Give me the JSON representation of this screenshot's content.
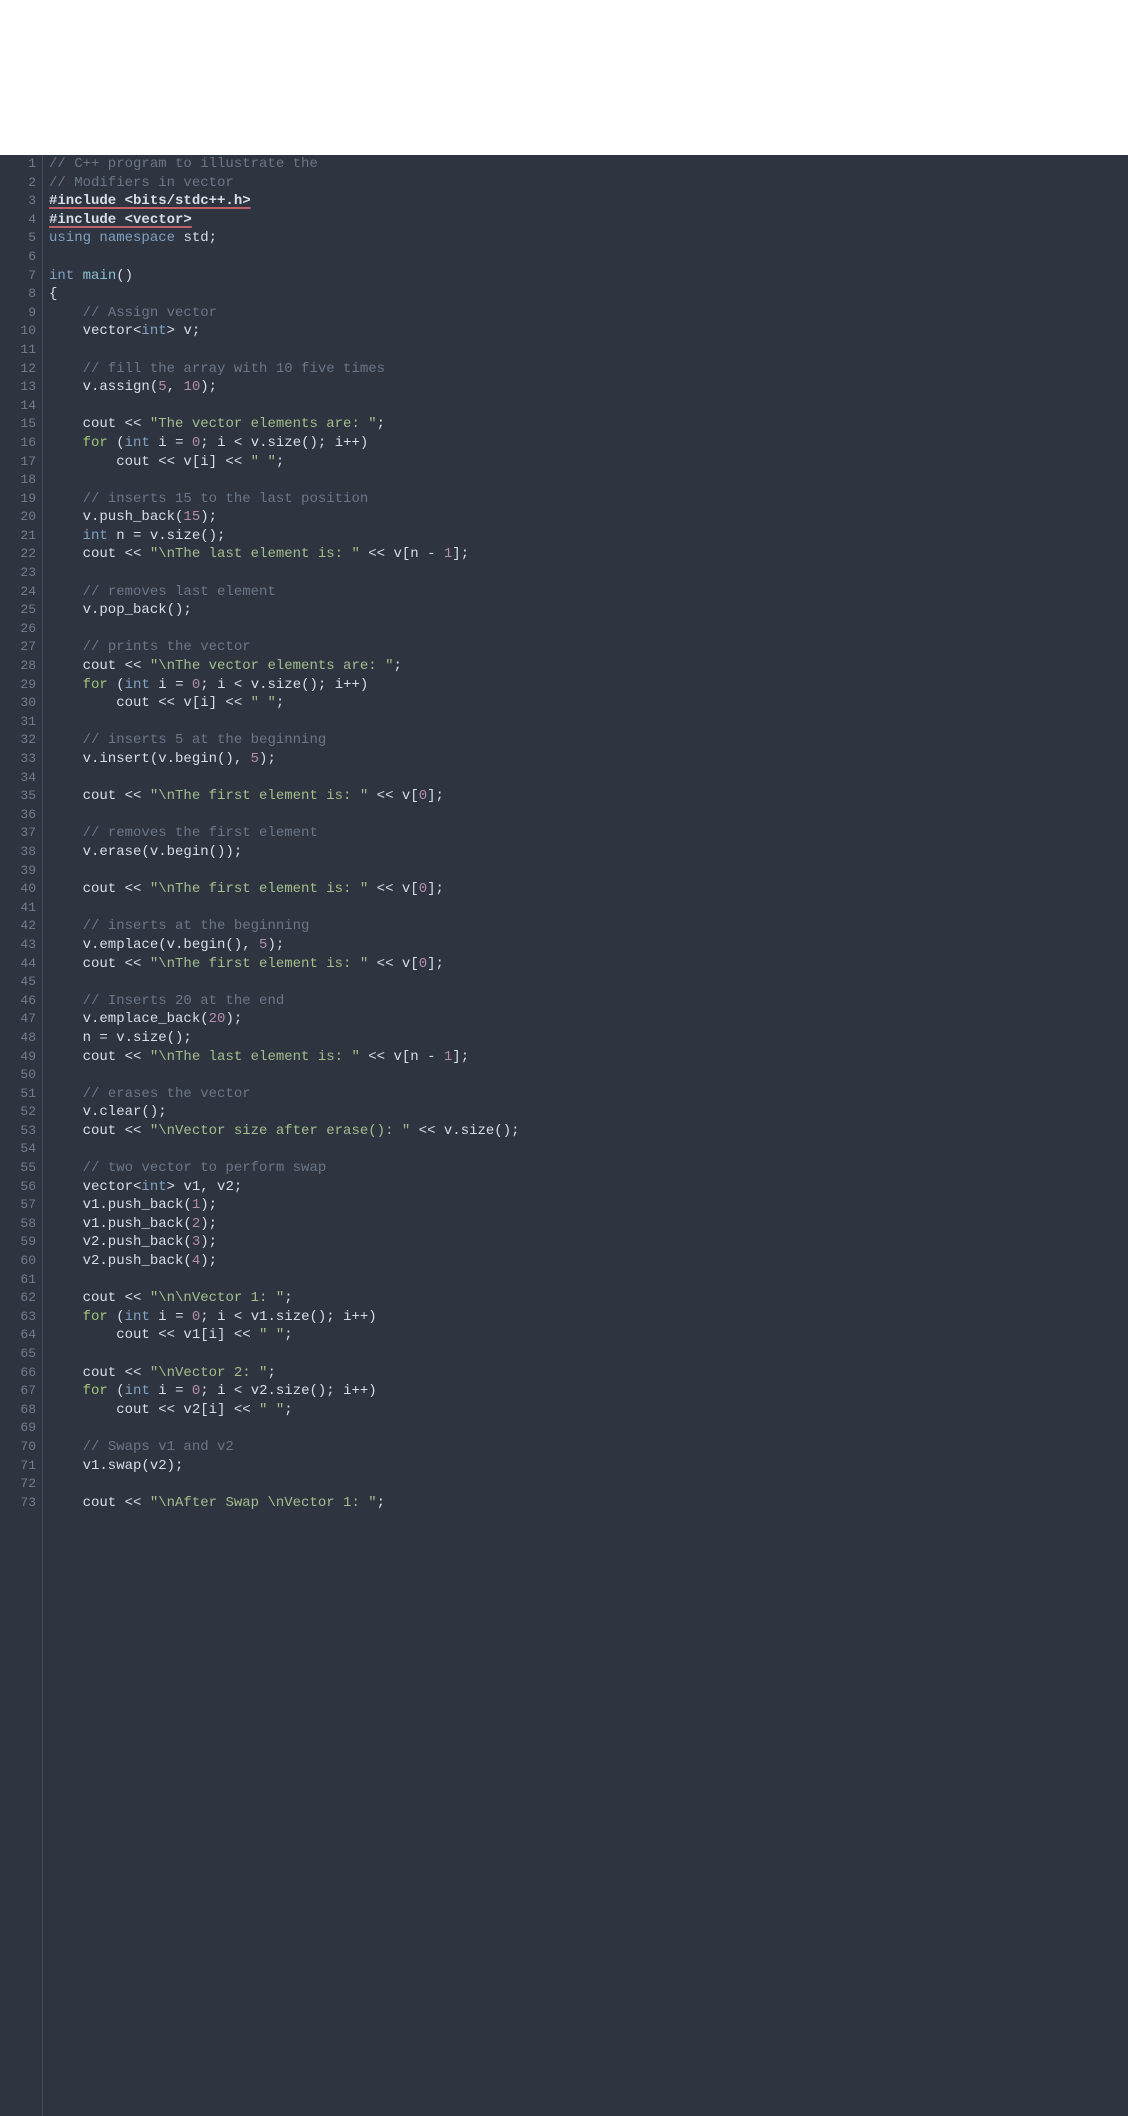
{
  "lines": [
    {
      "n": 1,
      "segs": [
        {
          "c": "tok-comment",
          "t": "// C++ program to illustrate the"
        }
      ]
    },
    {
      "n": 2,
      "segs": [
        {
          "c": "tok-comment",
          "t": "// Modifiers in vector"
        }
      ]
    },
    {
      "n": 3,
      "segs": [
        {
          "c": "tok-preproc tok-preproc-u",
          "t": "#include <bits/stdc++.h>"
        }
      ]
    },
    {
      "n": 4,
      "segs": [
        {
          "c": "tok-preproc tok-preproc-u",
          "t": "#include <vector>"
        }
      ]
    },
    {
      "n": 5,
      "segs": [
        {
          "c": "tok-keyword",
          "t": "using "
        },
        {
          "c": "tok-keyword",
          "t": "namespace "
        },
        {
          "c": "tok-default",
          "t": "std;"
        }
      ]
    },
    {
      "n": 6,
      "segs": []
    },
    {
      "n": 7,
      "segs": [
        {
          "c": "tok-keyword",
          "t": "int "
        },
        {
          "c": "tok-func",
          "t": "main"
        },
        {
          "c": "tok-default",
          "t": "()"
        }
      ]
    },
    {
      "n": 8,
      "segs": [
        {
          "c": "tok-default",
          "t": "{"
        }
      ]
    },
    {
      "n": 9,
      "segs": [
        {
          "c": "tok-default",
          "t": "    "
        },
        {
          "c": "tok-comment",
          "t": "// Assign vector"
        }
      ]
    },
    {
      "n": 10,
      "segs": [
        {
          "c": "tok-default",
          "t": "    vector<"
        },
        {
          "c": "tok-keyword",
          "t": "int"
        },
        {
          "c": "tok-default",
          "t": "> v;"
        }
      ]
    },
    {
      "n": 11,
      "segs": []
    },
    {
      "n": 12,
      "segs": [
        {
          "c": "tok-default",
          "t": "    "
        },
        {
          "c": "tok-comment",
          "t": "// fill the array with 10 five times"
        }
      ]
    },
    {
      "n": 13,
      "segs": [
        {
          "c": "tok-default",
          "t": "    v.assign("
        },
        {
          "c": "tok-number",
          "t": "5"
        },
        {
          "c": "tok-default",
          "t": ", "
        },
        {
          "c": "tok-number",
          "t": "10"
        },
        {
          "c": "tok-default",
          "t": ");"
        }
      ]
    },
    {
      "n": 14,
      "segs": []
    },
    {
      "n": 15,
      "segs": [
        {
          "c": "tok-default",
          "t": "    cout << "
        },
        {
          "c": "tok-string",
          "t": "\"The vector elements are: \""
        },
        {
          "c": "tok-default",
          "t": ";"
        }
      ]
    },
    {
      "n": 16,
      "segs": [
        {
          "c": "tok-default",
          "t": "    "
        },
        {
          "c": "tok-keyword2",
          "t": "for"
        },
        {
          "c": "tok-default",
          "t": " ("
        },
        {
          "c": "tok-keyword",
          "t": "int"
        },
        {
          "c": "tok-default",
          "t": " i = "
        },
        {
          "c": "tok-number",
          "t": "0"
        },
        {
          "c": "tok-default",
          "t": "; i < v.size(); i++)"
        }
      ]
    },
    {
      "n": 17,
      "segs": [
        {
          "c": "tok-default",
          "t": "        cout << v[i] << "
        },
        {
          "c": "tok-string",
          "t": "\" \""
        },
        {
          "c": "tok-default",
          "t": ";"
        }
      ]
    },
    {
      "n": 18,
      "segs": []
    },
    {
      "n": 19,
      "segs": [
        {
          "c": "tok-default",
          "t": "    "
        },
        {
          "c": "tok-comment",
          "t": "// inserts 15 to the last position"
        }
      ]
    },
    {
      "n": 20,
      "segs": [
        {
          "c": "tok-default",
          "t": "    v.push_back("
        },
        {
          "c": "tok-number",
          "t": "15"
        },
        {
          "c": "tok-default",
          "t": ");"
        }
      ]
    },
    {
      "n": 21,
      "segs": [
        {
          "c": "tok-default",
          "t": "    "
        },
        {
          "c": "tok-keyword",
          "t": "int"
        },
        {
          "c": "tok-default",
          "t": " n = v.size();"
        }
      ]
    },
    {
      "n": 22,
      "segs": [
        {
          "c": "tok-default",
          "t": "    cout << "
        },
        {
          "c": "tok-string",
          "t": "\"\\nThe last element is: \""
        },
        {
          "c": "tok-default",
          "t": " << v[n - "
        },
        {
          "c": "tok-number",
          "t": "1"
        },
        {
          "c": "tok-default",
          "t": "];"
        }
      ]
    },
    {
      "n": 23,
      "segs": []
    },
    {
      "n": 24,
      "segs": [
        {
          "c": "tok-default",
          "t": "    "
        },
        {
          "c": "tok-comment",
          "t": "// removes last element"
        }
      ]
    },
    {
      "n": 25,
      "segs": [
        {
          "c": "tok-default",
          "t": "    v.pop_back();"
        }
      ]
    },
    {
      "n": 26,
      "segs": []
    },
    {
      "n": 27,
      "segs": [
        {
          "c": "tok-default",
          "t": "    "
        },
        {
          "c": "tok-comment",
          "t": "// prints the vector"
        }
      ]
    },
    {
      "n": 28,
      "segs": [
        {
          "c": "tok-default",
          "t": "    cout << "
        },
        {
          "c": "tok-string",
          "t": "\"\\nThe vector elements are: \""
        },
        {
          "c": "tok-default",
          "t": ";"
        }
      ]
    },
    {
      "n": 29,
      "segs": [
        {
          "c": "tok-default",
          "t": "    "
        },
        {
          "c": "tok-keyword2",
          "t": "for"
        },
        {
          "c": "tok-default",
          "t": " ("
        },
        {
          "c": "tok-keyword",
          "t": "int"
        },
        {
          "c": "tok-default",
          "t": " i = "
        },
        {
          "c": "tok-number",
          "t": "0"
        },
        {
          "c": "tok-default",
          "t": "; i < v.size(); i++)"
        }
      ]
    },
    {
      "n": 30,
      "segs": [
        {
          "c": "tok-default",
          "t": "        cout << v[i] << "
        },
        {
          "c": "tok-string",
          "t": "\" \""
        },
        {
          "c": "tok-default",
          "t": ";"
        }
      ]
    },
    {
      "n": 31,
      "segs": []
    },
    {
      "n": 32,
      "segs": [
        {
          "c": "tok-default",
          "t": "    "
        },
        {
          "c": "tok-comment",
          "t": "// inserts 5 at the beginning"
        }
      ]
    },
    {
      "n": 33,
      "segs": [
        {
          "c": "tok-default",
          "t": "    v.insert(v.begin(), "
        },
        {
          "c": "tok-number",
          "t": "5"
        },
        {
          "c": "tok-default",
          "t": ");"
        }
      ]
    },
    {
      "n": 34,
      "segs": []
    },
    {
      "n": 35,
      "segs": [
        {
          "c": "tok-default",
          "t": "    cout << "
        },
        {
          "c": "tok-string",
          "t": "\"\\nThe first element is: \""
        },
        {
          "c": "tok-default",
          "t": " << v["
        },
        {
          "c": "tok-number",
          "t": "0"
        },
        {
          "c": "tok-default",
          "t": "];"
        }
      ]
    },
    {
      "n": 36,
      "segs": []
    },
    {
      "n": 37,
      "segs": [
        {
          "c": "tok-default",
          "t": "    "
        },
        {
          "c": "tok-comment",
          "t": "// removes the first element"
        }
      ]
    },
    {
      "n": 38,
      "segs": [
        {
          "c": "tok-default",
          "t": "    v.erase(v.begin());"
        }
      ]
    },
    {
      "n": 39,
      "segs": []
    },
    {
      "n": 40,
      "segs": [
        {
          "c": "tok-default",
          "t": "    cout << "
        },
        {
          "c": "tok-string",
          "t": "\"\\nThe first element is: \""
        },
        {
          "c": "tok-default",
          "t": " << v["
        },
        {
          "c": "tok-number",
          "t": "0"
        },
        {
          "c": "tok-default",
          "t": "];"
        }
      ]
    },
    {
      "n": 41,
      "segs": []
    },
    {
      "n": 42,
      "segs": [
        {
          "c": "tok-default",
          "t": "    "
        },
        {
          "c": "tok-comment",
          "t": "// inserts at the beginning"
        }
      ]
    },
    {
      "n": 43,
      "segs": [
        {
          "c": "tok-default",
          "t": "    v.emplace(v.begin(), "
        },
        {
          "c": "tok-number",
          "t": "5"
        },
        {
          "c": "tok-default",
          "t": ");"
        }
      ]
    },
    {
      "n": 44,
      "segs": [
        {
          "c": "tok-default",
          "t": "    cout << "
        },
        {
          "c": "tok-string",
          "t": "\"\\nThe first element is: \""
        },
        {
          "c": "tok-default",
          "t": " << v["
        },
        {
          "c": "tok-number",
          "t": "0"
        },
        {
          "c": "tok-default",
          "t": "];"
        }
      ]
    },
    {
      "n": 45,
      "segs": []
    },
    {
      "n": 46,
      "segs": [
        {
          "c": "tok-default",
          "t": "    "
        },
        {
          "c": "tok-comment",
          "t": "// Inserts 20 at the end"
        }
      ]
    },
    {
      "n": 47,
      "segs": [
        {
          "c": "tok-default",
          "t": "    v.emplace_back("
        },
        {
          "c": "tok-number",
          "t": "20"
        },
        {
          "c": "tok-default",
          "t": ");"
        }
      ]
    },
    {
      "n": 48,
      "segs": [
        {
          "c": "tok-default",
          "t": "    n = v.size();"
        }
      ]
    },
    {
      "n": 49,
      "segs": [
        {
          "c": "tok-default",
          "t": "    cout << "
        },
        {
          "c": "tok-string",
          "t": "\"\\nThe last element is: \""
        },
        {
          "c": "tok-default",
          "t": " << v[n - "
        },
        {
          "c": "tok-number",
          "t": "1"
        },
        {
          "c": "tok-default",
          "t": "];"
        }
      ]
    },
    {
      "n": 50,
      "segs": []
    },
    {
      "n": 51,
      "segs": [
        {
          "c": "tok-default",
          "t": "    "
        },
        {
          "c": "tok-comment",
          "t": "// erases the vector"
        }
      ]
    },
    {
      "n": 52,
      "segs": [
        {
          "c": "tok-default",
          "t": "    v.clear();"
        }
      ]
    },
    {
      "n": 53,
      "segs": [
        {
          "c": "tok-default",
          "t": "    cout << "
        },
        {
          "c": "tok-string",
          "t": "\"\\nVector size after erase(): \""
        },
        {
          "c": "tok-default",
          "t": " << v.size();"
        }
      ]
    },
    {
      "n": 54,
      "segs": []
    },
    {
      "n": 55,
      "segs": [
        {
          "c": "tok-default",
          "t": "    "
        },
        {
          "c": "tok-comment",
          "t": "// two vector to perform swap"
        }
      ]
    },
    {
      "n": 56,
      "segs": [
        {
          "c": "tok-default",
          "t": "    vector<"
        },
        {
          "c": "tok-keyword",
          "t": "int"
        },
        {
          "c": "tok-default",
          "t": "> v1, v2;"
        }
      ]
    },
    {
      "n": 57,
      "segs": [
        {
          "c": "tok-default",
          "t": "    v1.push_back("
        },
        {
          "c": "tok-number",
          "t": "1"
        },
        {
          "c": "tok-default",
          "t": ");"
        }
      ]
    },
    {
      "n": 58,
      "segs": [
        {
          "c": "tok-default",
          "t": "    v1.push_back("
        },
        {
          "c": "tok-number",
          "t": "2"
        },
        {
          "c": "tok-default",
          "t": ");"
        }
      ]
    },
    {
      "n": 59,
      "segs": [
        {
          "c": "tok-default",
          "t": "    v2.push_back("
        },
        {
          "c": "tok-number",
          "t": "3"
        },
        {
          "c": "tok-default",
          "t": ");"
        }
      ]
    },
    {
      "n": 60,
      "segs": [
        {
          "c": "tok-default",
          "t": "    v2.push_back("
        },
        {
          "c": "tok-number",
          "t": "4"
        },
        {
          "c": "tok-default",
          "t": ");"
        }
      ]
    },
    {
      "n": 61,
      "segs": []
    },
    {
      "n": 62,
      "segs": [
        {
          "c": "tok-default",
          "t": "    cout << "
        },
        {
          "c": "tok-string",
          "t": "\"\\n\\nVector 1: \""
        },
        {
          "c": "tok-default",
          "t": ";"
        }
      ]
    },
    {
      "n": 63,
      "segs": [
        {
          "c": "tok-default",
          "t": "    "
        },
        {
          "c": "tok-keyword2",
          "t": "for"
        },
        {
          "c": "tok-default",
          "t": " ("
        },
        {
          "c": "tok-keyword",
          "t": "int"
        },
        {
          "c": "tok-default",
          "t": " i = "
        },
        {
          "c": "tok-number",
          "t": "0"
        },
        {
          "c": "tok-default",
          "t": "; i < v1.size(); i++)"
        }
      ]
    },
    {
      "n": 64,
      "segs": [
        {
          "c": "tok-default",
          "t": "        cout << v1[i] << "
        },
        {
          "c": "tok-string",
          "t": "\" \""
        },
        {
          "c": "tok-default",
          "t": ";"
        }
      ]
    },
    {
      "n": 65,
      "segs": []
    },
    {
      "n": 66,
      "segs": [
        {
          "c": "tok-default",
          "t": "    cout << "
        },
        {
          "c": "tok-string",
          "t": "\"\\nVector 2: \""
        },
        {
          "c": "tok-default",
          "t": ";"
        }
      ]
    },
    {
      "n": 67,
      "segs": [
        {
          "c": "tok-default",
          "t": "    "
        },
        {
          "c": "tok-keyword2",
          "t": "for"
        },
        {
          "c": "tok-default",
          "t": " ("
        },
        {
          "c": "tok-keyword",
          "t": "int"
        },
        {
          "c": "tok-default",
          "t": " i = "
        },
        {
          "c": "tok-number",
          "t": "0"
        },
        {
          "c": "tok-default",
          "t": "; i < v2.size(); i++)"
        }
      ]
    },
    {
      "n": 68,
      "segs": [
        {
          "c": "tok-default",
          "t": "        cout << v2[i] << "
        },
        {
          "c": "tok-string",
          "t": "\" \""
        },
        {
          "c": "tok-default",
          "t": ";"
        }
      ]
    },
    {
      "n": 69,
      "segs": []
    },
    {
      "n": 70,
      "segs": [
        {
          "c": "tok-default",
          "t": "    "
        },
        {
          "c": "tok-comment",
          "t": "// Swaps v1 and v2"
        }
      ]
    },
    {
      "n": 71,
      "segs": [
        {
          "c": "tok-default",
          "t": "    v1.swap(v2);"
        }
      ]
    },
    {
      "n": 72,
      "segs": []
    },
    {
      "n": 73,
      "segs": [
        {
          "c": "tok-default",
          "t": "    cout << "
        },
        {
          "c": "tok-string",
          "t": "\"\\nAfter Swap \\nVector 1: \""
        },
        {
          "c": "tok-default",
          "t": ";"
        }
      ]
    }
  ]
}
